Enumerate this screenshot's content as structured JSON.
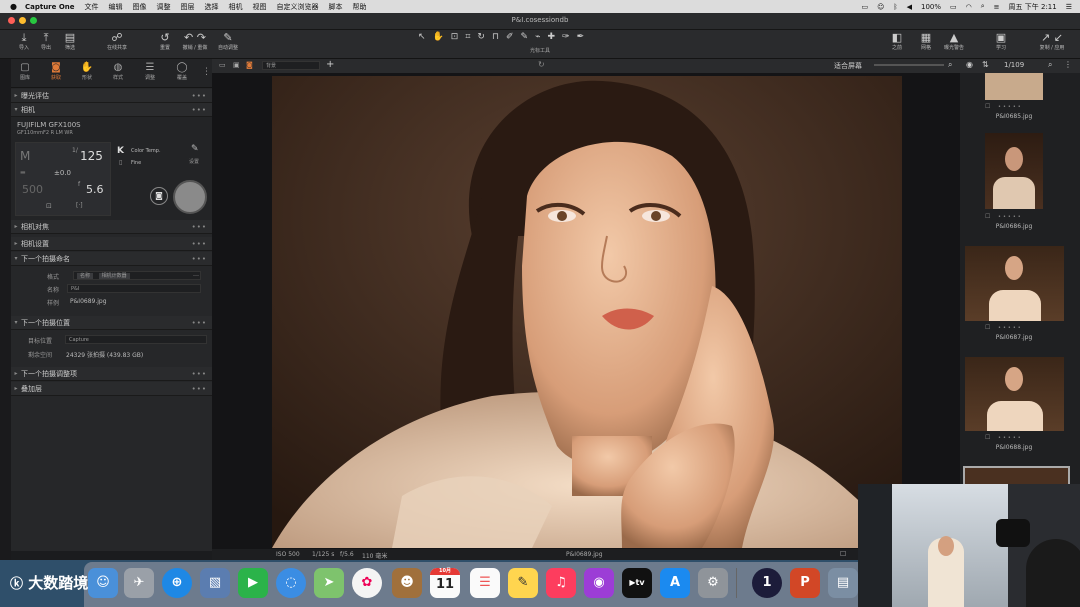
{
  "menubar": {
    "app_name": "Capture One",
    "items": [
      "文件",
      "编辑",
      "图像",
      "调整",
      "图层",
      "选择",
      "相机",
      "视图",
      "自定义浏览器",
      "脚本",
      "帮助"
    ],
    "battery": "100%",
    "clock": "周五 下午 2:11"
  },
  "window": {
    "title": "P&I.cosessiondb"
  },
  "toolbar": {
    "left": [
      {
        "icon": "import-icon",
        "label": "导入"
      },
      {
        "icon": "export-icon",
        "label": "导出"
      },
      {
        "icon": "filter-icon",
        "label": "筛选"
      },
      {
        "icon": "share-icon",
        "label": "在线共享"
      },
      {
        "icon": "reset-icon",
        "label": "重置"
      },
      {
        "icon": "undo-icon",
        "label": "撤销 / 重做"
      },
      {
        "icon": "auto-adjust-icon",
        "label": "自动调整"
      }
    ],
    "center_label": "光标工具",
    "right": [
      {
        "icon": "before-icon",
        "label": "之前"
      },
      {
        "icon": "grid-icon",
        "label": "网格"
      },
      {
        "icon": "exposure-warning-icon",
        "label": "曝光警告"
      },
      {
        "icon": "learn-icon",
        "label": "学习"
      },
      {
        "icon": "copy-apply-icon",
        "label": "复制 / 应用"
      }
    ]
  },
  "left_tabs": [
    {
      "icon": "library-icon",
      "label": "图库"
    },
    {
      "icon": "camera-tab-icon",
      "label": "获取"
    },
    {
      "icon": "shape-icon",
      "label": "形状"
    },
    {
      "icon": "style-icon",
      "label": "样式"
    },
    {
      "icon": "adjust-icon",
      "label": "调整"
    },
    {
      "icon": "mask-icon",
      "label": "覆盖"
    }
  ],
  "panels": {
    "exposure_eval": "曝光评估",
    "camera": "相机",
    "camera_model": "FUJIFILM GFX100S",
    "camera_lens": "GF110mmF2 R LM WR",
    "mode": "M",
    "shutter": "125",
    "shutter_prefix": "1/",
    "ev": "±0.0",
    "aperture": "5.6",
    "aperture_prefix": "f",
    "iso": "500",
    "wb_letter": "K",
    "wb_label": "Color Temp.",
    "fine_label": "Fine",
    "settings_label": "设置",
    "camera_focus": "相机对焦",
    "camera_settings": "相机设置",
    "next_naming": "下一个拍摄命名",
    "format_label": "格式",
    "format_tokens": [
      "名称",
      "相机计数器"
    ],
    "name_label": "名称",
    "name_value": "P&I",
    "sample_label": "样例",
    "sample_value": "P&I0689.jpg",
    "next_location": "下一个拍摄位置",
    "dest_label": "目标位置",
    "dest_value": "Capture",
    "space_label": "剩余空间",
    "space_value": "24329 张拍摄 (439.83 GB)",
    "next_adjust": "下一个拍摄调整项",
    "overlay": "叠加层"
  },
  "viewbar": {
    "style_select": "背景",
    "fit_label": "适合屏幕"
  },
  "statusbar": {
    "iso": "ISO 500",
    "shutter": "1/125 s",
    "aperture": "f/5.6",
    "focal": "110 毫米",
    "filename": "P&I0689.jpg"
  },
  "browser": {
    "counter": "1/109",
    "thumbnails": [
      {
        "filename": "P&I0685.jpg"
      },
      {
        "filename": "P&I0686.jpg"
      },
      {
        "filename": "P&I0687.jpg"
      },
      {
        "filename": "P&I0688.jpg"
      }
    ]
  },
  "dock": {
    "calendar_day": "11",
    "calendar_month": "10月"
  },
  "watermark": "大数踏境"
}
